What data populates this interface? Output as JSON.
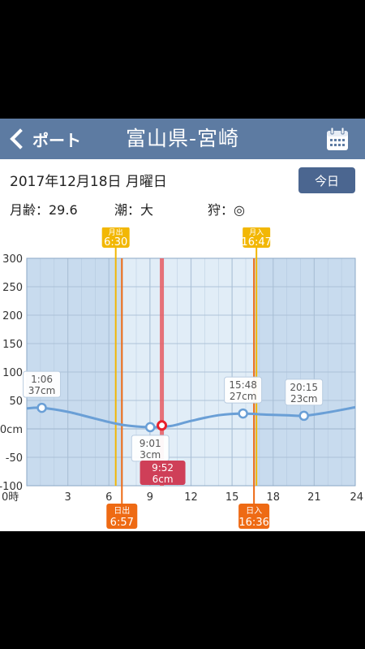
{
  "header": {
    "back_label": "ポート",
    "title": "富山県-宮崎"
  },
  "info": {
    "date": "2017年12月18日 月曜日",
    "today_label": "今日",
    "moon_age": "月齢：29.6",
    "tide_type": "潮：大",
    "fishing": "狩：◎"
  },
  "chart_data": {
    "type": "line",
    "xlim": [
      0,
      24
    ],
    "ylim": [
      -100,
      300
    ],
    "x_ticks": [
      "0時",
      "3",
      "6",
      "9",
      "12",
      "15",
      "18",
      "21",
      "24"
    ],
    "y_ticks": [
      "300",
      "250",
      "200",
      "150",
      "100",
      "50",
      "0cm",
      "-50",
      "-100"
    ],
    "x": [
      0,
      1.1,
      3,
      5,
      7,
      9.02,
      10.5,
      12,
      14,
      15.8,
      17.5,
      19,
      20.25,
      22,
      24
    ],
    "y": [
      36,
      37,
      30,
      18,
      7,
      3,
      5,
      14,
      24,
      27,
      25,
      24,
      23,
      29,
      38
    ],
    "extremes": [
      {
        "time": "1:06",
        "height": "37cm",
        "x": 1.1,
        "y": 37
      },
      {
        "time": "9:01",
        "height": "3cm",
        "x": 9.02,
        "y": 3
      },
      {
        "time": "15:48",
        "height": "27cm",
        "x": 15.8,
        "y": 27
      },
      {
        "time": "20:15",
        "height": "23cm",
        "x": 20.25,
        "y": 23
      }
    ],
    "current": {
      "time": "9:52",
      "height": "6cm",
      "x": 9.87,
      "y": 6
    },
    "moonrise": {
      "label": "月出",
      "time": "6:30",
      "x": 6.5
    },
    "moonset": {
      "label": "月入",
      "time": "16:47",
      "x": 16.78
    },
    "sunrise": {
      "label": "日出",
      "time": "6:57",
      "x": 6.95
    },
    "sunset": {
      "label": "日入",
      "time": "16:36",
      "x": 16.6
    },
    "colors": {
      "tide_line": "#6a9fd6",
      "current": "#e85c63",
      "moon": "#f2b705",
      "sun": "#ee6a14",
      "night_bg": "#c8dbee",
      "day_bg": "#e1edf7",
      "grid": "#a9bfd6"
    }
  }
}
